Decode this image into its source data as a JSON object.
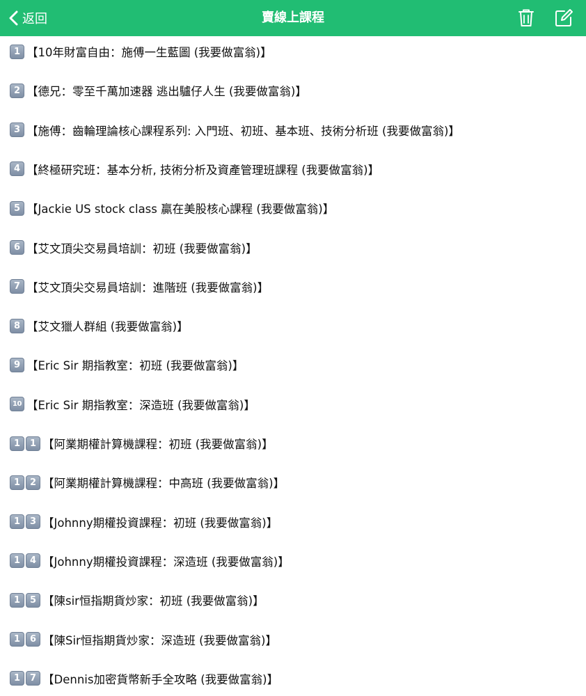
{
  "navbar": {
    "back_label": "返回",
    "title": "賣線上課程",
    "icons": {
      "back": "chevron-left-icon",
      "trash": "trash-icon",
      "compose": "compose-icon"
    },
    "bg_color": "#21bd73"
  },
  "items": [
    {
      "badges": [
        "1"
      ],
      "text": "【10年財富自由：施傅一生藍圖 (我要做富翁)】"
    },
    {
      "badges": [
        "2"
      ],
      "text": "【德兄：零至千萬加速器  逃出驢仔人生 (我要做富翁)】"
    },
    {
      "badges": [
        "3"
      ],
      "text": "【施傅：齒輪理論核心課程系列: 入門班、初班、基本班、技術分析班 (我要做富翁)】"
    },
    {
      "badges": [
        "4"
      ],
      "text": "【終極研究班：基本分析, 技術分析及資產管理班課程 (我要做富翁)】"
    },
    {
      "badges": [
        "5"
      ],
      "text": "【Jackie US stock class 贏在美股核心課程  (我要做富翁)】"
    },
    {
      "badges": [
        "6"
      ],
      "text": "【艾文頂尖交易員培訓：初班 (我要做富翁)】"
    },
    {
      "badges": [
        "7"
      ],
      "text": "【艾文頂尖交易員培訓：進階班 (我要做富翁)】"
    },
    {
      "badges": [
        "8"
      ],
      "text": "【艾文獵人群組 (我要做富翁)】"
    },
    {
      "badges": [
        "9"
      ],
      "text": "【Eric Sir 期指教室：初班 (我要做富翁)】"
    },
    {
      "badges": [
        "10"
      ],
      "text": "【Eric Sir 期指教室：深造班 (我要做富翁)】"
    },
    {
      "badges": [
        "1",
        "1"
      ],
      "text": "【阿業期權計算機課程：初班 (我要做富翁)】"
    },
    {
      "badges": [
        "1",
        "2"
      ],
      "text": "【阿業期權計算機課程：中高班 (我要做富翁)】"
    },
    {
      "badges": [
        "1",
        "3"
      ],
      "text": "【Johnny期權投資課程：初班 (我要做富翁)】"
    },
    {
      "badges": [
        "1",
        "4"
      ],
      "text": "【Johnny期權投資課程：深造班 (我要做富翁)】"
    },
    {
      "badges": [
        "1",
        "5"
      ],
      "text": "【陳sir恒指期貨炒家：初班 (我要做富翁)】"
    },
    {
      "badges": [
        "1",
        "6"
      ],
      "text": "【陳Sir恒指期貨炒家：深造班  (我要做富翁)】"
    },
    {
      "badges": [
        "1",
        "7"
      ],
      "text": "【Dennis加密貨幣新手全攻略 (我要做富翁)】"
    }
  ]
}
